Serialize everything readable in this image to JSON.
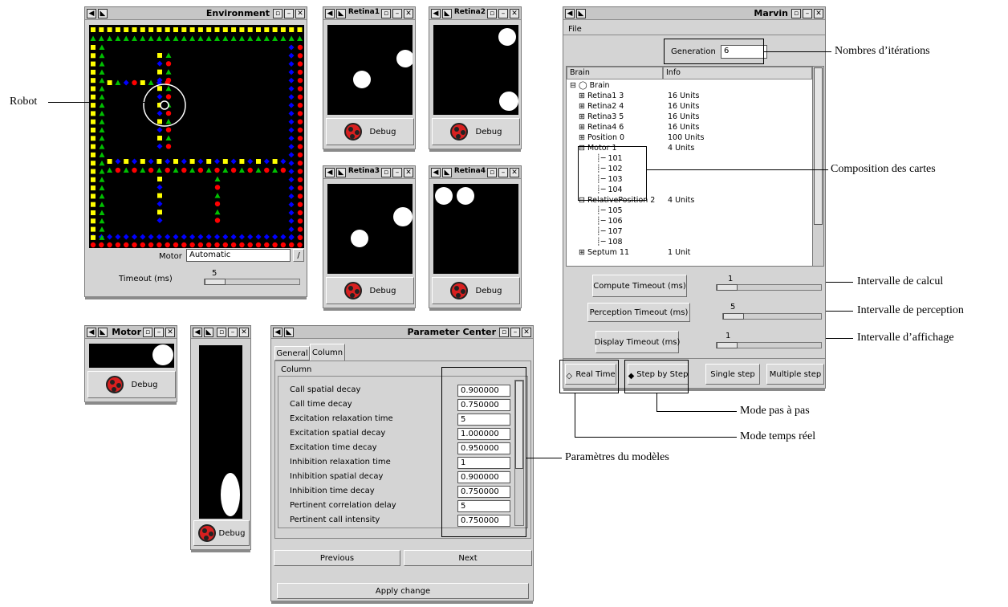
{
  "environment": {
    "title": "Environment",
    "motor_label": "Motor",
    "motor_value": "Automatic",
    "timeout_label": "Timeout (ms)",
    "timeout_value": "5"
  },
  "retinas": [
    {
      "title": "Retina1",
      "debug": "Debug"
    },
    {
      "title": "Retina2",
      "debug": "Debug"
    },
    {
      "title": "Retina3",
      "debug": "Debug"
    },
    {
      "title": "Retina4",
      "debug": "Debug"
    }
  ],
  "motor_window": {
    "title": "Motor",
    "debug": "Debug"
  },
  "position_window": {
    "debug": "Debug"
  },
  "parameter_center": {
    "title": "Parameter Center",
    "tabs": [
      "General",
      "Column"
    ],
    "group_label": "Column",
    "rows": [
      {
        "name": "Call spatial decay",
        "value": "0.900000"
      },
      {
        "name": "Call time decay",
        "value": "0.750000"
      },
      {
        "name": "Excitation relaxation time",
        "value": "5"
      },
      {
        "name": "Excitation spatial decay",
        "value": "1.000000"
      },
      {
        "name": "Excitation time decay",
        "value": "0.950000"
      },
      {
        "name": "Inhibition relaxation time",
        "value": "1"
      },
      {
        "name": "Inhibition spatial decay",
        "value": "0.900000"
      },
      {
        "name": "Inhibition time decay",
        "value": "0.750000"
      },
      {
        "name": "Pertinent correlation delay",
        "value": "5"
      },
      {
        "name": "Pertinent call intensity",
        "value": "0.750000"
      }
    ],
    "previous": "Previous",
    "next": "Next",
    "apply": "Apply change"
  },
  "marvin": {
    "title": "Marvin",
    "menu_file": "File",
    "generation_label": "Generation",
    "generation_value": "6",
    "col_brain": "Brain",
    "col_info": "Info",
    "tree": [
      {
        "label": "Brain",
        "info": ""
      },
      {
        "label": "Retina1 3",
        "info": "16 Units"
      },
      {
        "label": "Retina2 4",
        "info": "16 Units"
      },
      {
        "label": "Retina3 5",
        "info": "16 Units"
      },
      {
        "label": "Retina4 6",
        "info": "16 Units"
      },
      {
        "label": "Position 0",
        "info": "100 Units"
      },
      {
        "label": "Motor 1",
        "info": "4 Units"
      },
      {
        "label": "101",
        "info": ""
      },
      {
        "label": "102",
        "info": ""
      },
      {
        "label": "103",
        "info": ""
      },
      {
        "label": "104",
        "info": ""
      },
      {
        "label": "RelativePosition 2",
        "info": "4 Units"
      },
      {
        "label": "105",
        "info": ""
      },
      {
        "label": "106",
        "info": ""
      },
      {
        "label": "107",
        "info": ""
      },
      {
        "label": "108",
        "info": ""
      },
      {
        "label": "Septum 11",
        "info": "1 Unit"
      }
    ],
    "compute_label": "Compute Timeout (ms)",
    "compute_value": "1",
    "perception_label": "Perception Timeout (ms)",
    "perception_value": "5",
    "display_label": "Display Timeout (ms)",
    "display_value": "1",
    "real_time": "Real Time",
    "step_by_step": "Step by Step",
    "single_step": "Single step",
    "multiple_step": "Multiple step"
  },
  "annotations": {
    "robot": "Robot",
    "iterations": "Nombres d’itérations",
    "composition": "Composition des cartes",
    "calcul": "Intervalle de calcul",
    "perception": "Intervalle de perception",
    "affichage": "Intervalle d’affichage",
    "pas_a_pas": "Mode pas à pas",
    "temps_reel": "Mode temps réel",
    "parametres": "Paramètres du modèles"
  },
  "colors": {
    "red": "#ff0000",
    "blue": "#0000ff",
    "green": "#00c000",
    "yellow": "#ffff00"
  }
}
